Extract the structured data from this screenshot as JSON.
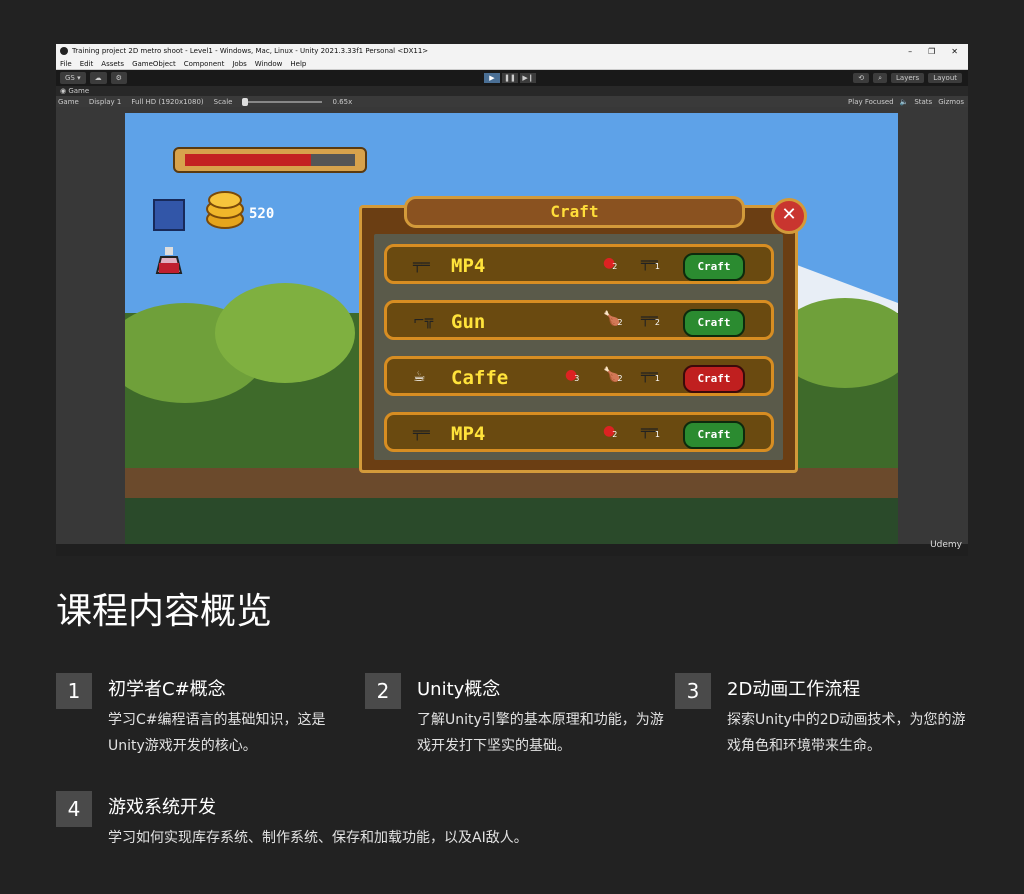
{
  "window": {
    "title": "Training project 2D metro shoot - Level1 - Windows, Mac, Linux - Unity 2021.3.33f1 Personal <DX11>",
    "controls": [
      "–",
      "❐",
      "✕"
    ]
  },
  "menu": [
    "File",
    "Edit",
    "Assets",
    "GameObject",
    "Component",
    "Jobs",
    "Window",
    "Help"
  ],
  "toolbar": {
    "account": "GS ▾",
    "right": [
      "Layers",
      "Layout"
    ]
  },
  "game_tab": {
    "label": "Game",
    "view_select": "Game",
    "display": "Display 1",
    "resolution": "Full HD (1920x1080)",
    "scale_label": "Scale",
    "scale_value": "0.65x",
    "right": [
      "Play Focused",
      "Stats",
      "Gizmos"
    ]
  },
  "hud": {
    "health_fraction": 0.74,
    "coins": "520"
  },
  "craft_panel": {
    "title": "Craft",
    "rows": [
      {
        "name": "MP4",
        "icon": "rifle-icon",
        "ingredients": [
          {
            "icon": "apple-icon",
            "count": "2"
          },
          {
            "icon": "rifle-icon",
            "count": "1"
          }
        ],
        "button": "Craft",
        "button_color": "#2b8b30"
      },
      {
        "name": "Gun",
        "icon": "pistol-icon",
        "ingredients": [
          {
            "icon": "drumstick-icon",
            "count": "2"
          },
          {
            "icon": "rifle-icon",
            "count": "2"
          }
        ],
        "button": "Craft",
        "button_color": "#2b8b30"
      },
      {
        "name": "Caffe",
        "icon": "coffee-icon",
        "ingredients": [
          {
            "icon": "apple-icon",
            "count": "3"
          },
          {
            "icon": "drumstick-icon",
            "count": "2"
          },
          {
            "icon": "rifle-icon",
            "count": "1"
          }
        ],
        "button": "Craft",
        "button_color": "#c01f1f"
      },
      {
        "name": "MP4",
        "icon": "rifle-icon",
        "ingredients": [
          {
            "icon": "apple-icon",
            "count": "2"
          },
          {
            "icon": "rifle-icon",
            "count": "1"
          }
        ],
        "button": "Craft",
        "button_color": "#2b8b30"
      }
    ]
  },
  "watermark": "Udemy",
  "section": {
    "heading": "课程内容概览",
    "topics": [
      {
        "num": "1",
        "title": "初学者C#概念",
        "desc": "学习C#编程语言的基础知识，这是Unity游戏开发的核心。"
      },
      {
        "num": "2",
        "title": "Unity概念",
        "desc": "了解Unity引擎的基本原理和功能，为游戏开发打下坚实的基础。"
      },
      {
        "num": "3",
        "title": "2D动画工作流程",
        "desc": "探索Unity中的2D动画技术，为您的游戏角色和环境带来生命。"
      },
      {
        "num": "4",
        "title": "游戏系统开发",
        "desc": "学习如何实现库存系统、制作系统、保存和加载功能，以及AI敌人。"
      }
    ]
  }
}
